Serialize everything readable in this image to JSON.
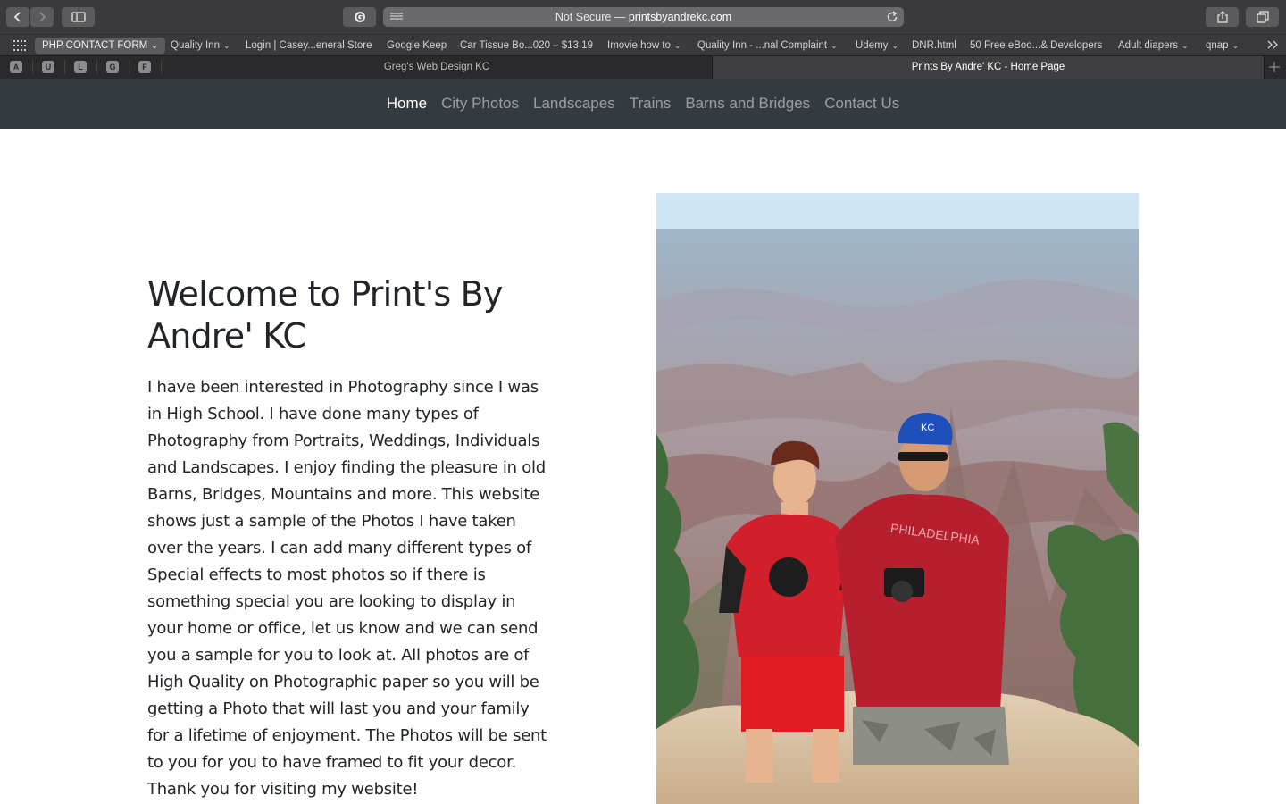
{
  "browser": {
    "url_prefix": "Not Secure —",
    "url_domain": "printsbyandrekc.com",
    "bookmarks": [
      {
        "label": "PHP CONTACT FORM",
        "dropdown": true
      },
      {
        "label": "Quality Inn",
        "dropdown": true
      },
      {
        "label": "Login | Casey...eneral Store",
        "dropdown": false
      },
      {
        "label": "Google Keep",
        "dropdown": false
      },
      {
        "label": "Car Tissue Bo...020 – $13.19",
        "dropdown": false
      },
      {
        "label": "Imovie how to",
        "dropdown": true
      },
      {
        "label": "Quality Inn - ...nal Complaint",
        "dropdown": true
      },
      {
        "label": "Udemy",
        "dropdown": true
      },
      {
        "label": "DNR.html",
        "dropdown": false
      },
      {
        "label": "50 Free eBoo...& Developers",
        "dropdown": false
      },
      {
        "label": "Adult diapers",
        "dropdown": true
      },
      {
        "label": "qnap",
        "dropdown": true
      }
    ],
    "pinned_tabs": [
      "A",
      "U",
      "L",
      "G",
      "F"
    ],
    "tabs": [
      {
        "title": "Greg's Web Design KC",
        "active": false
      },
      {
        "title": "Prints By Andre' KC - Home Page",
        "active": true
      }
    ]
  },
  "site": {
    "nav": [
      {
        "label": "Home",
        "active": true
      },
      {
        "label": "City Photos",
        "active": false
      },
      {
        "label": "Landscapes",
        "active": false
      },
      {
        "label": "Trains",
        "active": false
      },
      {
        "label": "Barns and Bridges",
        "active": false
      },
      {
        "label": "Contact Us",
        "active": false
      }
    ],
    "heading": "Welcome to Print's By Andre' KC",
    "body": "I have been interested in Photography since I was in High School. I have done many types of Photography from Portraits, Weddings, Individuals and Landscapes. I enjoy finding the pleasure in old Barns, Bridges, Mountains and more. This website shows just a sample of the Photos I have taken over the years. I can add many different types of Special effects to most photos so if there is something special you are looking to display in your home or office, let us know and we can send you a sample for you to look at. All photos are of High Quality on Photographic paper so you will be getting a Photo that will last you and your family for a lifetime of enjoyment. The Photos will be sent to you for you to have framed to fit your decor. Thank you for visiting my website!",
    "photo_caps": {
      "hat": "KC",
      "shirt_right": "PHILADELPHIA"
    }
  },
  "colors": {
    "navbar": "#343a40",
    "text": "#212529",
    "chrome": "#3a3a3c"
  }
}
